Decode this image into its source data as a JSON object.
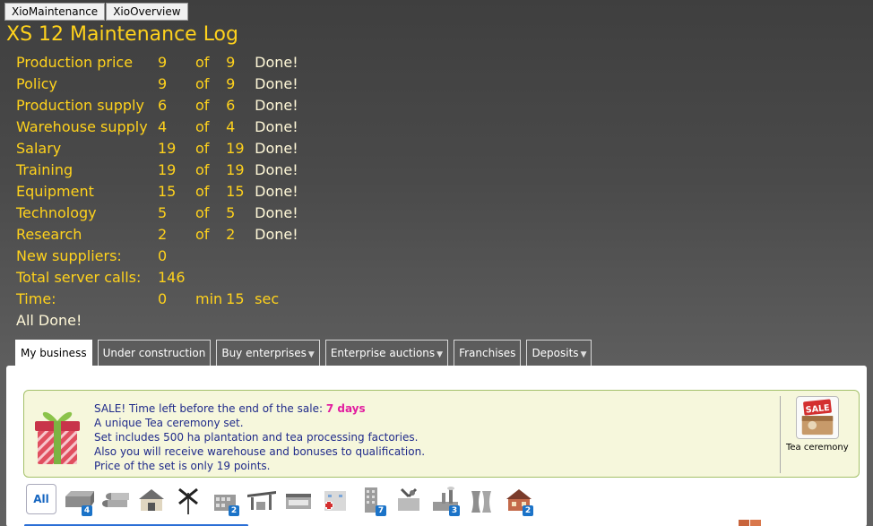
{
  "topbar": {
    "buttons": [
      "XioMaintenance",
      "XioOverview"
    ]
  },
  "log": {
    "title": "XS 12 Maintenance Log",
    "rows": [
      {
        "label": "Production price",
        "current": "9",
        "of": "of",
        "total": "9",
        "status": "Done!"
      },
      {
        "label": "Policy",
        "current": "9",
        "of": "of",
        "total": "9",
        "status": "Done!"
      },
      {
        "label": "Production supply",
        "current": "6",
        "of": "of",
        "total": "6",
        "status": "Done!"
      },
      {
        "label": "Warehouse supply",
        "current": "4",
        "of": "of",
        "total": "4",
        "status": "Done!"
      },
      {
        "label": "Salary",
        "current": "19",
        "of": "of",
        "total": "19",
        "status": "Done!"
      },
      {
        "label": "Training",
        "current": "19",
        "of": "of",
        "total": "19",
        "status": "Done!"
      },
      {
        "label": "Equipment",
        "current": "15",
        "of": "of",
        "total": "15",
        "status": "Done!"
      },
      {
        "label": "Technology",
        "current": "5",
        "of": "of",
        "total": "5",
        "status": "Done!"
      },
      {
        "label": "Research",
        "current": "2",
        "of": "of",
        "total": "2",
        "status": "Done!"
      }
    ],
    "new_suppliers": {
      "label": "New suppliers:",
      "value": "0"
    },
    "server_calls": {
      "label": "Total server calls:",
      "value": "146"
    },
    "time": {
      "label": "Time:",
      "min_value": "0",
      "min_unit": "min",
      "sec_value": "15",
      "sec_unit": "sec"
    },
    "all_done": "All Done!"
  },
  "tabs": [
    {
      "label": "My business",
      "dropdown": false,
      "active": true
    },
    {
      "label": "Under construction",
      "dropdown": false,
      "active": false
    },
    {
      "label": "Buy enterprises",
      "dropdown": true,
      "active": false
    },
    {
      "label": "Enterprise auctions",
      "dropdown": true,
      "active": false
    },
    {
      "label": "Franchises",
      "dropdown": false,
      "active": false
    },
    {
      "label": "Deposits",
      "dropdown": true,
      "active": false
    }
  ],
  "promo": {
    "line1_prefix": "SALE! Time left before the end of the sale:",
    "line1_days": "7 days",
    "line2": "A unique Tea ceremony set.",
    "line3": "Set includes 500 ha plantation and tea processing factories.",
    "line4": "Also you will receive warehouse and bonuses to qualification.",
    "line5": "Price of the set is only 19 points.",
    "side_caption": "Tea ceremony",
    "sale_badge_text": "SALE"
  },
  "filter": {
    "all_label": "All",
    "icons": [
      {
        "name": "warehouse-icon",
        "badge": "4"
      },
      {
        "name": "pipes-icon",
        "badge": ""
      },
      {
        "name": "farm-icon",
        "badge": ""
      },
      {
        "name": "windmill-icon",
        "badge": ""
      },
      {
        "name": "factory-icon",
        "badge": "2"
      },
      {
        "name": "gas-station-icon",
        "badge": ""
      },
      {
        "name": "shop-icon",
        "badge": ""
      },
      {
        "name": "hospital-icon",
        "badge": ""
      },
      {
        "name": "office-tower-icon",
        "badge": "7"
      },
      {
        "name": "workshop-icon",
        "badge": ""
      },
      {
        "name": "plant-icon",
        "badge": "3"
      },
      {
        "name": "cooling-tower-icon",
        "badge": ""
      },
      {
        "name": "restaurant-icon",
        "badge": "2"
      }
    ]
  },
  "colors": {
    "log_text": "#ffd21c",
    "done_text": "#fff8d8",
    "promo_text": "#1f2a8a",
    "promo_highlight": "#e21ea0",
    "badge_bg": "#1b73c8"
  }
}
